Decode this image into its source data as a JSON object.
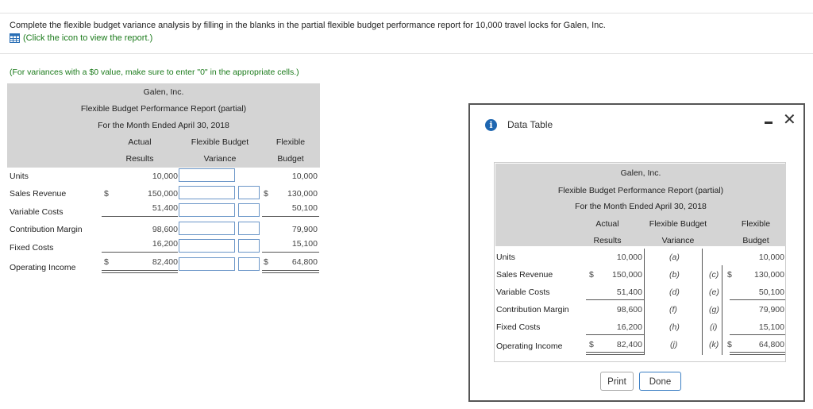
{
  "question": {
    "text": "Complete the flexible budget variance analysis by filling in the blanks in the partial flexible budget performance report for 10,000 travel locks for Galen, Inc.",
    "link_label": "(Click the icon to view the report.)",
    "note": "(For variances with a $0 value, make sure to enter \"0\" in the appropriate cells.)"
  },
  "report": {
    "company": "Galen, Inc.",
    "title": "Flexible Budget Performance Report (partial)",
    "period": "For the Month Ended April 30, 2018",
    "col_actual_1": "Actual",
    "col_actual_2": "Results",
    "col_fbv_1": "Flexible Budget",
    "col_fbv_2": "Variance",
    "col_fb_1": "Flexible",
    "col_fb_2": "Budget",
    "dollar": "$",
    "rows": [
      {
        "label": "Units",
        "actual": "10,000",
        "budget": "10,000"
      },
      {
        "label": "Sales Revenue",
        "actual": "150,000",
        "budget": "130,000"
      },
      {
        "label": "Variable Costs",
        "actual": "51,400",
        "budget": "50,100"
      },
      {
        "label": "Contribution Margin",
        "actual": "98,600",
        "budget": "79,900"
      },
      {
        "label": "Fixed Costs",
        "actual": "16,200",
        "budget": "15,100"
      },
      {
        "label": "Operating Income",
        "actual": "82,400",
        "budget": "64,800"
      }
    ]
  },
  "dialog": {
    "title": "Data Table",
    "info_icon": "info-icon",
    "letters": [
      "(a)",
      "(b)",
      "(c)",
      "(d)",
      "(e)",
      "(f)",
      "(g)",
      "(h)",
      "(i)",
      "(j)",
      "(k)"
    ],
    "print_label": "Print",
    "done_label": "Done"
  },
  "colors": {
    "accent_green": "#1a7a1a",
    "input_border": "#6b96c8",
    "header_gray": "#d4d4d4",
    "info_blue": "#1e66b0"
  }
}
